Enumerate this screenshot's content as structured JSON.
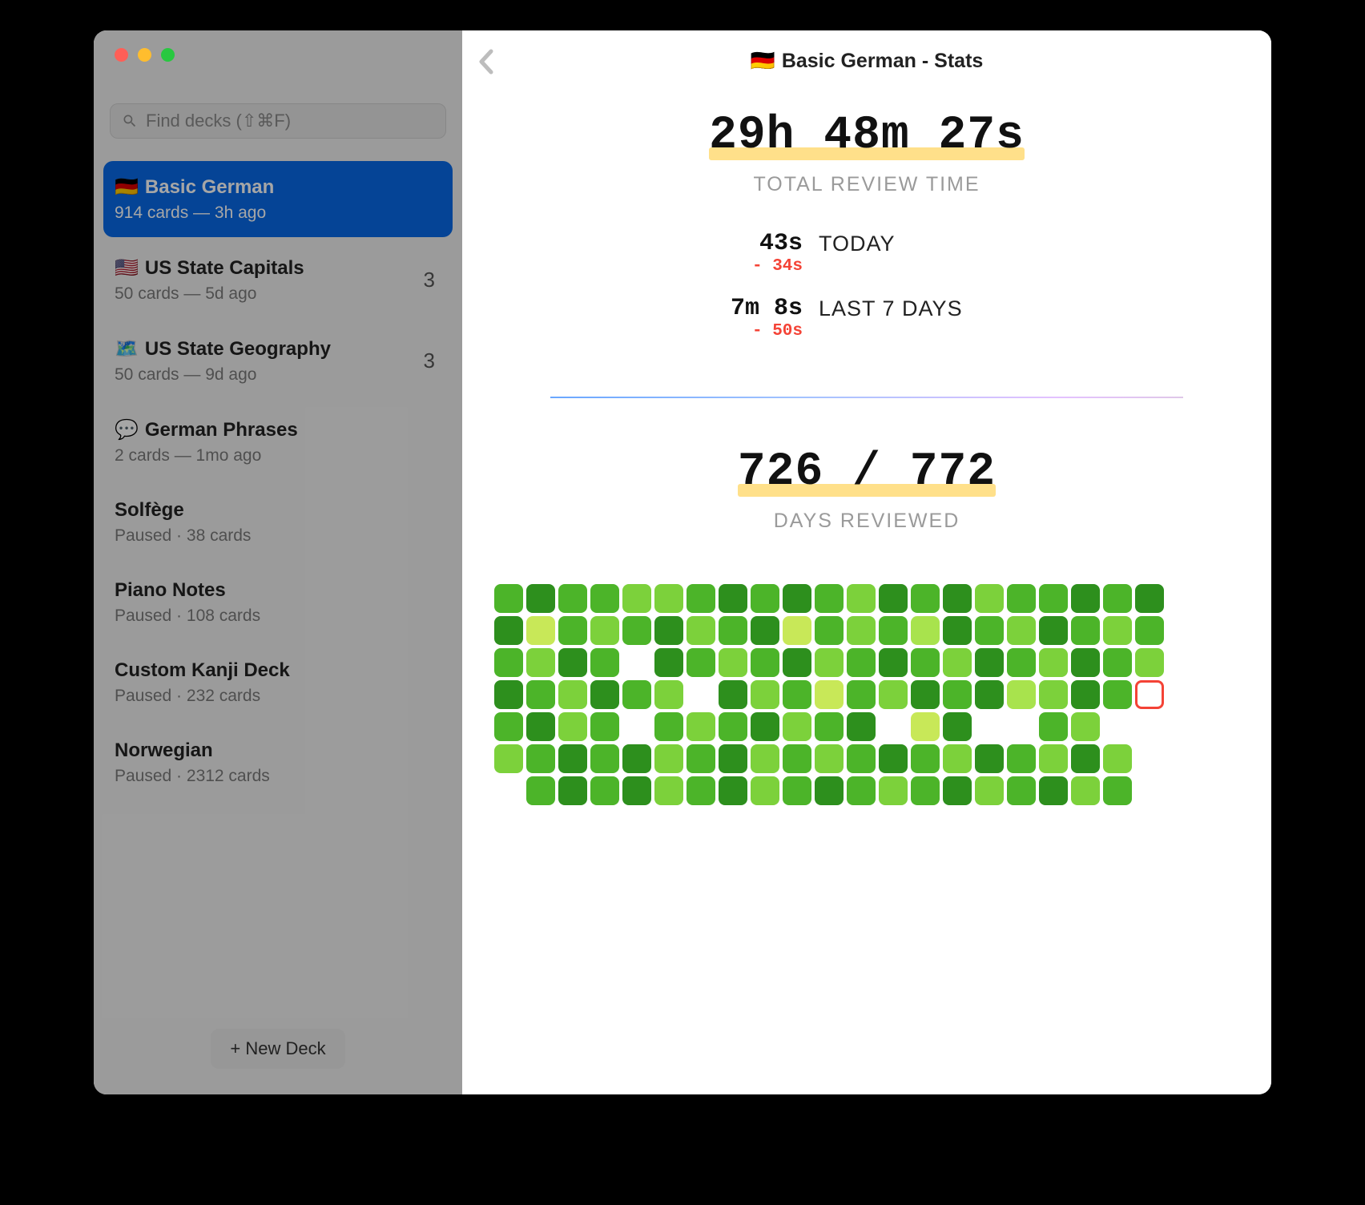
{
  "search": {
    "placeholder": "Find decks (⇧⌘F)"
  },
  "sidebar": {
    "decks": [
      {
        "emoji": "🇩🇪",
        "title": "Basic German",
        "sub": "914 cards — 3h ago",
        "badge": "",
        "selected": true
      },
      {
        "emoji": "🇺🇸",
        "title": "US State Capitals",
        "sub": "50 cards — 5d ago",
        "badge": "3",
        "selected": false
      },
      {
        "emoji": "🗺️",
        "title": "US State Geography",
        "sub": "50 cards — 9d ago",
        "badge": "3",
        "selected": false
      },
      {
        "emoji": "💬",
        "title": "German Phrases",
        "sub": "2 cards — 1mo ago",
        "badge": "",
        "selected": false
      },
      {
        "emoji": "",
        "title": "Solfège",
        "sub": "Paused · 38 cards",
        "badge": "",
        "selected": false
      },
      {
        "emoji": "",
        "title": "Piano Notes",
        "sub": "Paused · 108 cards",
        "badge": "",
        "selected": false
      },
      {
        "emoji": "",
        "title": "Custom Kanji Deck",
        "sub": "Paused · 232 cards",
        "badge": "",
        "selected": false
      },
      {
        "emoji": "",
        "title": "Norwegian",
        "sub": "Paused · 2312 cards",
        "badge": "",
        "selected": false
      }
    ],
    "new_deck_label": "+ New Deck"
  },
  "header": {
    "emoji": "🇩🇪",
    "title": "Basic German - Stats"
  },
  "stats": {
    "total_review_time": "29h 48m 27s",
    "total_review_time_label": "TOTAL REVIEW TIME",
    "today_value": "43s",
    "today_delta": "- 34s",
    "today_label": "TODAY",
    "week_value": "7m 8s",
    "week_delta": "- 50s",
    "week_label": "LAST 7 DAYS",
    "days_reviewed": "726 / 772",
    "days_reviewed_label": "DAYS REVIEWED"
  },
  "chart_data": {
    "type": "heatmap",
    "title": "Days Reviewed",
    "legend": [
      "none",
      "light",
      "medium",
      "heavy",
      "very heavy",
      "lime"
    ],
    "cols": 21,
    "rows": 7,
    "cells": [
      3,
      4,
      3,
      3,
      2,
      2,
      3,
      4,
      3,
      4,
      3,
      2,
      4,
      3,
      4,
      2,
      3,
      3,
      4,
      3,
      4,
      4,
      5,
      3,
      2,
      3,
      4,
      2,
      3,
      4,
      5,
      3,
      2,
      3,
      1,
      4,
      3,
      2,
      4,
      3,
      2,
      3,
      3,
      2,
      4,
      3,
      0,
      4,
      3,
      2,
      3,
      4,
      2,
      3,
      4,
      3,
      2,
      4,
      3,
      2,
      4,
      3,
      2,
      4,
      3,
      2,
      4,
      3,
      2,
      0,
      4,
      2,
      3,
      5,
      3,
      2,
      4,
      3,
      4,
      1,
      2,
      4,
      3,
      6,
      3,
      4,
      2,
      3,
      0,
      3,
      2,
      3,
      4,
      2,
      3,
      4,
      0,
      5,
      4,
      0,
      0,
      3,
      2,
      0,
      0,
      2,
      3,
      4,
      3,
      4,
      2,
      3,
      4,
      2,
      3,
      2,
      3,
      4,
      3,
      2,
      4,
      3,
      2,
      4,
      2,
      0,
      0,
      3,
      4,
      3,
      4,
      2,
      3,
      4,
      2,
      3,
      4,
      3,
      2,
      3,
      4,
      2,
      3,
      4,
      2,
      3,
      0
    ]
  }
}
